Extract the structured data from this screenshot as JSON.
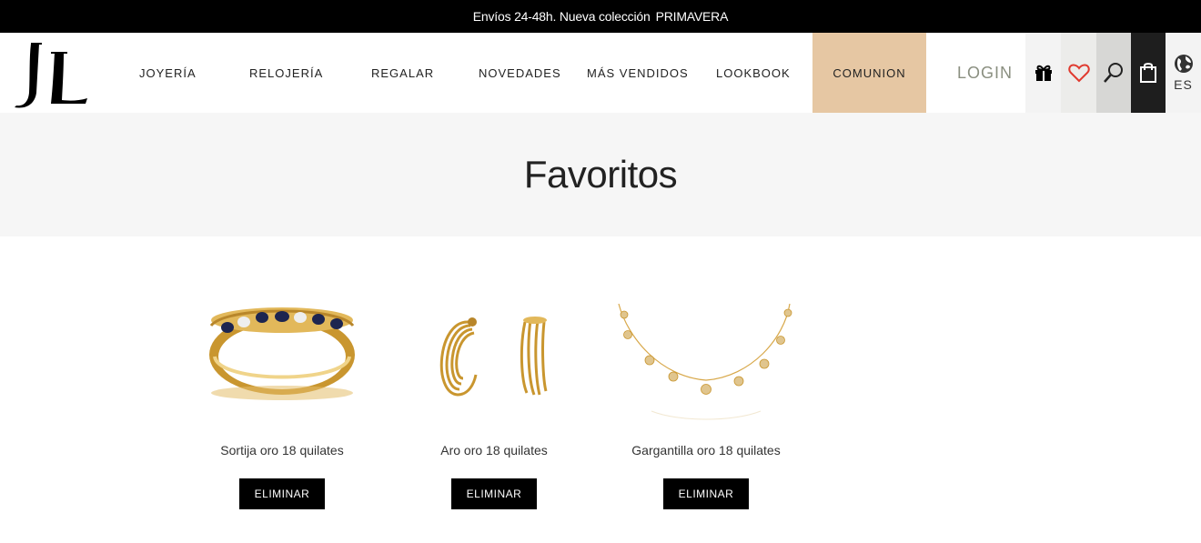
{
  "announcement": {
    "text": "Envíos 24-48h. Nueva colección",
    "highlight": "PRIMAVERA"
  },
  "logo": {
    "text": "JL"
  },
  "nav": {
    "items": [
      "JOYERÍA",
      "RELOJERÍA",
      "REGALAR",
      "NOVEDADES",
      "MÁS VENDIDOS",
      "LOOKBOOK"
    ],
    "comunion": "COMUNION",
    "login": "LOGIN"
  },
  "header_icons": {
    "gift": "gift-icon",
    "wishlist": "heart-icon",
    "search": "search-icon",
    "cart": "shopping-bag-icon",
    "language": "globe-icon",
    "language_code": "ES"
  },
  "page": {
    "title": "Favoritos"
  },
  "products": [
    {
      "name": "Sortija oro 18 quilates",
      "button": "ELIMINAR",
      "image": "ring"
    },
    {
      "name": "Aro oro 18 quilates",
      "button": "ELIMINAR",
      "image": "hoop-earrings"
    },
    {
      "name": "Gargantilla oro 18 quilates",
      "button": "ELIMINAR",
      "image": "necklace"
    }
  ],
  "colors": {
    "accent": "#e6c7a3",
    "heart": "#e03a2f",
    "gold": "#d8a84a",
    "dark": "#000000"
  }
}
